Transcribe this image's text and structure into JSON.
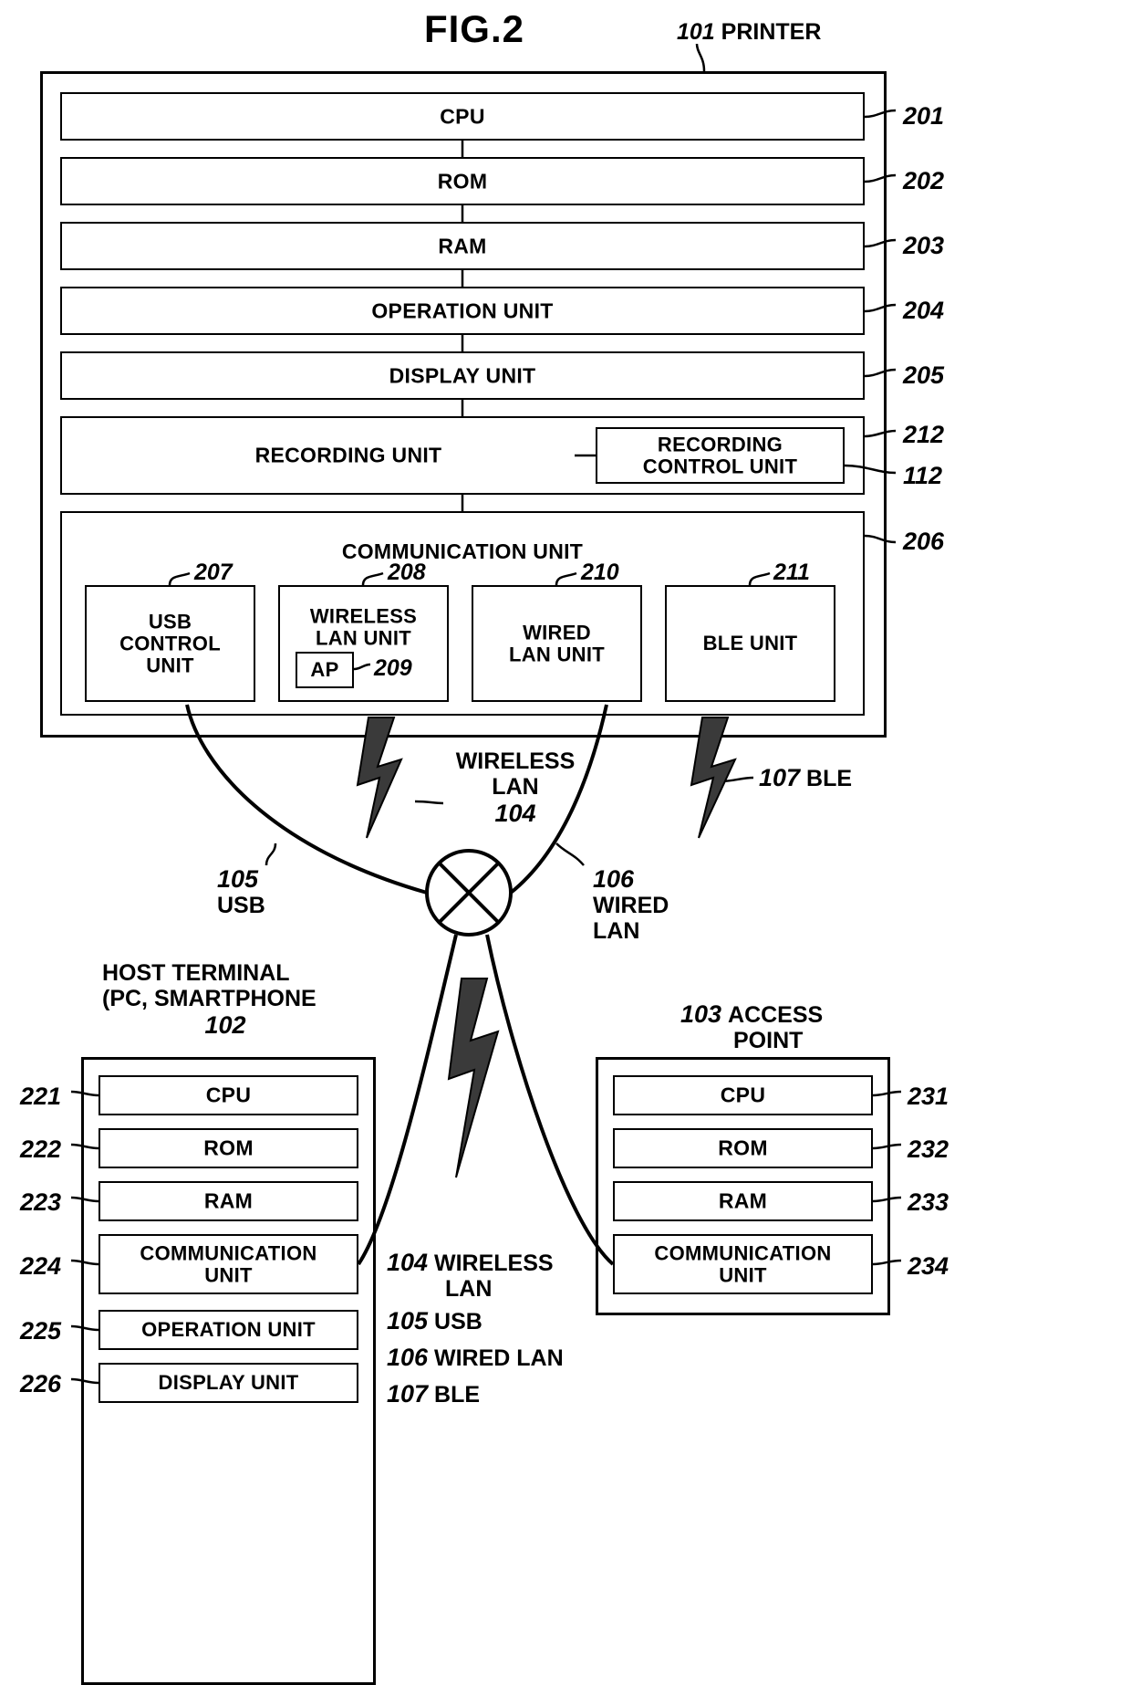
{
  "figure": {
    "title": "FIG.2"
  },
  "printer": {
    "ref": "101",
    "name": "PRINTER",
    "units": [
      {
        "ref": "201",
        "label": "CPU"
      },
      {
        "ref": "202",
        "label": "ROM"
      },
      {
        "ref": "203",
        "label": "RAM"
      },
      {
        "ref": "204",
        "label": "OPERATION UNIT"
      },
      {
        "ref": "205",
        "label": "DISPLAY UNIT"
      }
    ],
    "recording": {
      "ref": "212",
      "label": "RECORDING UNIT",
      "control": {
        "ref": "112",
        "line1": "RECORDING",
        "line2": "CONTROL UNIT"
      }
    },
    "communication": {
      "ref": "206",
      "label": "COMMUNICATION UNIT",
      "subunits": [
        {
          "ref": "207",
          "line1": "USB",
          "line2": "CONTROL",
          "line3": "UNIT"
        },
        {
          "ref": "208",
          "line1": "WIRELESS",
          "line2": "LAN UNIT",
          "ap": {
            "ref": "209",
            "label": "AP"
          }
        },
        {
          "ref": "210",
          "line1": "WIRED",
          "line2": "LAN UNIT"
        },
        {
          "ref": "211",
          "line1": "BLE UNIT"
        }
      ]
    }
  },
  "links": {
    "wireless_lan": {
      "ref": "104",
      "line1": "WIRELESS",
      "line2": "LAN"
    },
    "ble": {
      "ref": "107",
      "label": "BLE"
    },
    "usb": {
      "ref": "105",
      "label": "USB"
    },
    "wired_lan": {
      "ref": "106",
      "line1": "WIRED",
      "line2": "LAN"
    }
  },
  "host": {
    "ref": "102",
    "title_line1": "HOST TERMINAL",
    "title_line2": "(PC, SMARTPHONE",
    "units": [
      {
        "ref": "221",
        "label": "CPU"
      },
      {
        "ref": "222",
        "label": "ROM"
      },
      {
        "ref": "223",
        "label": "RAM"
      },
      {
        "ref": "224",
        "line1": "COMMUNICATION",
        "line2": "UNIT"
      },
      {
        "ref": "225",
        "label": "OPERATION UNIT"
      },
      {
        "ref": "226",
        "label": "DISPLAY UNIT"
      }
    ]
  },
  "access_point": {
    "ref": "103",
    "title_line1": "ACCESS",
    "title_line2": "POINT",
    "units": [
      {
        "ref": "231",
        "label": "CPU"
      },
      {
        "ref": "232",
        "label": "ROM"
      },
      {
        "ref": "233",
        "label": "RAM"
      },
      {
        "ref": "234",
        "line1": "COMMUNICATION",
        "line2": "UNIT"
      }
    ]
  },
  "legend": [
    {
      "ref": "104",
      "label": "WIRELESS"
    },
    {
      "ref": "104b",
      "label": "LAN"
    },
    {
      "ref": "105",
      "label": "USB"
    },
    {
      "ref": "106",
      "label": "WIRED LAN"
    },
    {
      "ref": "107",
      "label": "BLE"
    }
  ],
  "legend_lines": {
    "l1_ref": "104",
    "l1_a": "WIRELESS",
    "l1_b": "LAN",
    "l2_ref": "105",
    "l2": "USB",
    "l3_ref": "106",
    "l3": "WIRED LAN",
    "l4_ref": "107",
    "l4": "BLE"
  }
}
